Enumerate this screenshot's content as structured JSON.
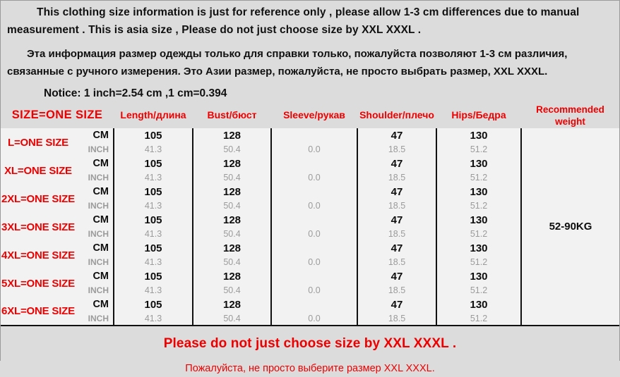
{
  "colors": {
    "accent_red": "#ee0000",
    "page_background": "#dcdcdc",
    "table_background": "#f2f2f2",
    "inch_text": "#9b9b9b",
    "border": "#111111"
  },
  "intro": {
    "english": "This clothing size information is just for reference only , please allow 1-3 cm differences due to manual measurement . This  is asia size , Please do not just choose size by XXL XXXL .",
    "russian": "Эта информация размер одежды только для справки только, пожалуйста позволяют 1-3 см  различия, связанные с ручного измерения. Это Азии размер, пожалуйста, не просто выбрать размер, XXL XXXL.",
    "notice": "Notice: 1 inch=2.54 cm ,1 cm=0.394"
  },
  "table": {
    "headers": {
      "size": "SIZE=ONE SIZE",
      "length": "Length/длина",
      "bust": "Bust/бюст",
      "sleeve": "Sleeve/рукав",
      "shoulder": "Shoulder/плечо",
      "hips": "Hips/Бедра",
      "weight_line1": "Recommended",
      "weight_line2": "weight"
    },
    "unit_labels": {
      "cm": "CM",
      "inch": "INCH"
    },
    "recommended_weight": "52-90KG",
    "rows": [
      {
        "size": "L=ONE SIZE",
        "cm": {
          "length": "105",
          "bust": "128",
          "sleeve": "",
          "shoulder": "47",
          "hips": "130"
        },
        "inch": {
          "length": "41.3",
          "bust": "50.4",
          "sleeve": "0.0",
          "shoulder": "18.5",
          "hips": "51.2"
        }
      },
      {
        "size": "XL=ONE SIZE",
        "cm": {
          "length": "105",
          "bust": "128",
          "sleeve": "",
          "shoulder": "47",
          "hips": "130"
        },
        "inch": {
          "length": "41.3",
          "bust": "50.4",
          "sleeve": "0.0",
          "shoulder": "18.5",
          "hips": "51.2"
        }
      },
      {
        "size": "2XL=ONE SIZE",
        "cm": {
          "length": "105",
          "bust": "128",
          "sleeve": "",
          "shoulder": "47",
          "hips": "130"
        },
        "inch": {
          "length": "41.3",
          "bust": "50.4",
          "sleeve": "0.0",
          "shoulder": "18.5",
          "hips": "51.2"
        }
      },
      {
        "size": "3XL=ONE SIZE",
        "cm": {
          "length": "105",
          "bust": "128",
          "sleeve": "",
          "shoulder": "47",
          "hips": "130"
        },
        "inch": {
          "length": "41.3",
          "bust": "50.4",
          "sleeve": "0.0",
          "shoulder": "18.5",
          "hips": "51.2"
        }
      },
      {
        "size": "4XL=ONE SIZE",
        "cm": {
          "length": "105",
          "bust": "128",
          "sleeve": "",
          "shoulder": "47",
          "hips": "130"
        },
        "inch": {
          "length": "41.3",
          "bust": "50.4",
          "sleeve": "0.0",
          "shoulder": "18.5",
          "hips": "51.2"
        }
      },
      {
        "size": "5XL=ONE SIZE",
        "cm": {
          "length": "105",
          "bust": "128",
          "sleeve": "",
          "shoulder": "47",
          "hips": "130"
        },
        "inch": {
          "length": "41.3",
          "bust": "50.4",
          "sleeve": "0.0",
          "shoulder": "18.5",
          "hips": "51.2"
        }
      },
      {
        "size": "6XL=ONE SIZE",
        "cm": {
          "length": "105",
          "bust": "128",
          "sleeve": "",
          "shoulder": "47",
          "hips": "130"
        },
        "inch": {
          "length": "41.3",
          "bust": "50.4",
          "sleeve": "0.0",
          "shoulder": "18.5",
          "hips": "51.2"
        }
      }
    ]
  },
  "footer": {
    "english": "Please do not just choose size by XXL XXXL .",
    "russian": "Пожалуйста, не просто выберите размер XXL XXXL."
  }
}
